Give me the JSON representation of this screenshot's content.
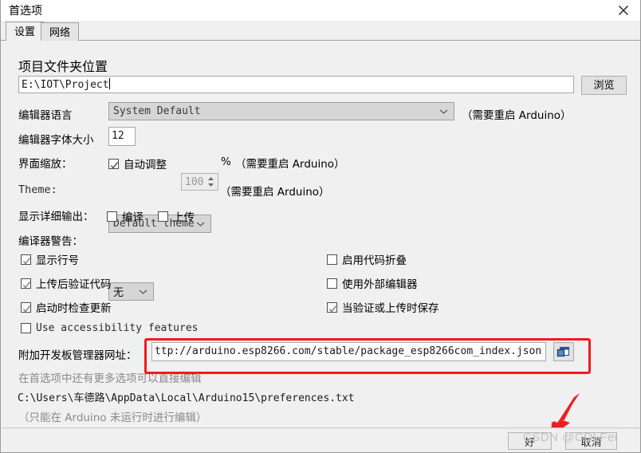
{
  "window": {
    "title": "首选项",
    "close_icon": "close-icon"
  },
  "tabs": [
    {
      "label": "设置",
      "active": true
    },
    {
      "label": "网络",
      "active": false
    }
  ],
  "settings": {
    "sketchbook_label": "项目文件夹位置",
    "sketchbook_value": "E:\\IOT\\Project",
    "browse_button": "浏览",
    "language_label": "编辑器语言",
    "language_value": "System Default",
    "language_note": "（需要重启 Arduino）",
    "fontsize_label": "编辑器字体大小",
    "fontsize_value": "12",
    "scale_label": "界面缩放：",
    "scale_auto_label": "自动调整",
    "scale_auto_checked": true,
    "scale_value": "100",
    "scale_percent": "%",
    "scale_note": "（需要重启 Arduino）",
    "theme_label": "Theme:",
    "theme_value": "Default theme",
    "theme_note": "（需要重启 Arduino）",
    "verbose_label": "显示详细输出：",
    "verbose_compile_label": "编译",
    "verbose_compile_checked": false,
    "verbose_upload_label": "上传",
    "verbose_upload_checked": false,
    "warnings_label": "编译器警告：",
    "warnings_value": "无"
  },
  "checkboxes_left": [
    {
      "label": "显示行号",
      "checked": true,
      "lang": "zh"
    },
    {
      "label": "上传后验证代码",
      "checked": true,
      "lang": "zh"
    },
    {
      "label": "启动时检查更新",
      "checked": true,
      "lang": "zh"
    },
    {
      "label": "Use accessibility features",
      "checked": false,
      "lang": "en"
    }
  ],
  "checkboxes_right": [
    {
      "label": "启用代码折叠",
      "checked": false,
      "lang": "zh"
    },
    {
      "label": "使用外部编辑器",
      "checked": false,
      "lang": "zh"
    },
    {
      "label": "当验证或上传时保存",
      "checked": true,
      "lang": "zh"
    }
  ],
  "boards_urls": {
    "label": "附加开发板管理器网址：",
    "value": "ttp://arduino.esp8266.com/stable/package_esp8266com_index.json",
    "edit_icon": "open-window-icon"
  },
  "footer_notes": {
    "line1": "在首选项中还有更多选项可以直接编辑",
    "line2": "C:\\Users\\车德路\\AppData\\Local\\Arduino15\\preferences.txt",
    "line3": "（只能在 Arduino 未运行时进行编辑）"
  },
  "dialog_buttons": {
    "ok": "好",
    "cancel": "取消"
  },
  "annotations": {
    "highlight_color": "#ef1c1c",
    "arrow_color": "#ef1c1c",
    "watermark": "CSDN @CDLFei"
  }
}
